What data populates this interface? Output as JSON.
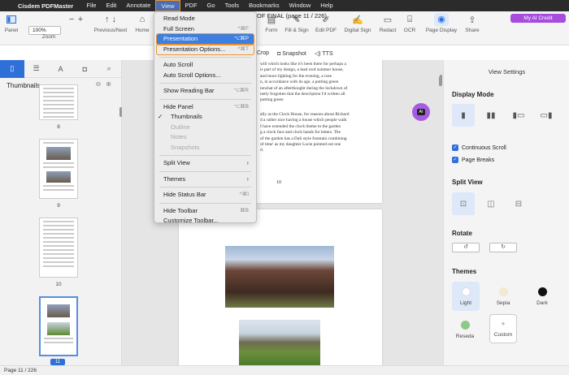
{
  "menubar": {
    "app_name": "Cisdem PDFMaster",
    "items": [
      "File",
      "Edit",
      "Annotate",
      "View",
      "PDF",
      "Go",
      "Tools",
      "Bookmarks",
      "Window",
      "Help"
    ]
  },
  "toolbar": {
    "panel": "Panel",
    "zoom_value": "100%",
    "zoom": "Zoom",
    "prev_next": "Previous/Next",
    "home": "Home",
    "form": "Form",
    "fill_sign": "Fill & Sign",
    "edit_pdf": "Edit PDF",
    "digital_sign": "Digital Sign",
    "redact": "Redact",
    "ocr": "OCR",
    "page_display": "Page Display",
    "share": "Share",
    "ai_credit": "My AI Credit",
    "title_fragment": "OF FINAL (page 11 / 226)"
  },
  "subtoolbar": {
    "crop": "Crop",
    "snapshot": "Snapshot",
    "tts": "TTS"
  },
  "view_menu": {
    "read_mode": "Read Mode",
    "full_screen": "Full Screen",
    "full_screen_sc": "^⌘F",
    "presentation": "Presentation",
    "presentation_sc": "⌥⌘P",
    "presentation_options": "Presentation Options...",
    "presentation_options_sc": "^⌘T",
    "auto_scroll": "Auto Scroll",
    "auto_scroll_options": "Auto Scroll Options...",
    "show_reading_bar": "Show Reading Bar",
    "show_reading_bar_sc": "⌥⌘R",
    "hide_panel": "Hide Panel",
    "hide_panel_sc": "⌥⌘B",
    "thumbnails": "Thumbnails",
    "outline": "Outline",
    "notes": "Notes",
    "snapshots": "Snapshots",
    "split_view": "Split View",
    "themes": "Themes",
    "hide_status_bar": "Hide Status Bar",
    "hide_status_bar_sc": "^⌘I",
    "hide_toolbar": "Hide Toolbar",
    "hide_toolbar_sc": "⌘B",
    "customize_toolbar": "Customize Toolbar..."
  },
  "sidebar": {
    "title": "Thumbnails",
    "page_numbers": [
      "8",
      "9",
      "10",
      "11"
    ]
  },
  "document": {
    "para1": "will which looks like it's been there for perhaps a\n is part of my design, a lead roof summer house,\n and moor lighting for the evening, a rose\nn, in accordance with its age, a putting green\nnewhat of an afterthought during the lockdown of\nnetly forgotten that the description I'd written all\n putting green",
    "para2": "ally as the Clock House, for reasons about Richard\nd a rather nice having a house which people walk\n I have extended the clock theme to the garden\ng a clock face and clock hands for letters. The\nof the garden has a Dali style fountain combining\n of time' as my daughter Lucie pointed out one\nd.",
    "page_number": "10"
  },
  "right_panel": {
    "title": "View Settings",
    "display_mode": "Display Mode",
    "continuous_scroll": "Continuous Scroll",
    "page_breaks": "Page Breaks",
    "split_view": "Split View",
    "rotate": "Rotate",
    "themes": "Themes",
    "theme_light": "Light",
    "theme_sepia": "Sepia",
    "theme_dark": "Dark",
    "theme_reseda": "Reseda",
    "theme_custom": "Custom",
    "colors": {
      "light": "#ffffff",
      "sepia": "#f3e8d2",
      "dark": "#111111",
      "reseda": "#8ec98a",
      "accent": "#2f6fd8"
    }
  },
  "status": {
    "page": "Page 11 / 226"
  }
}
